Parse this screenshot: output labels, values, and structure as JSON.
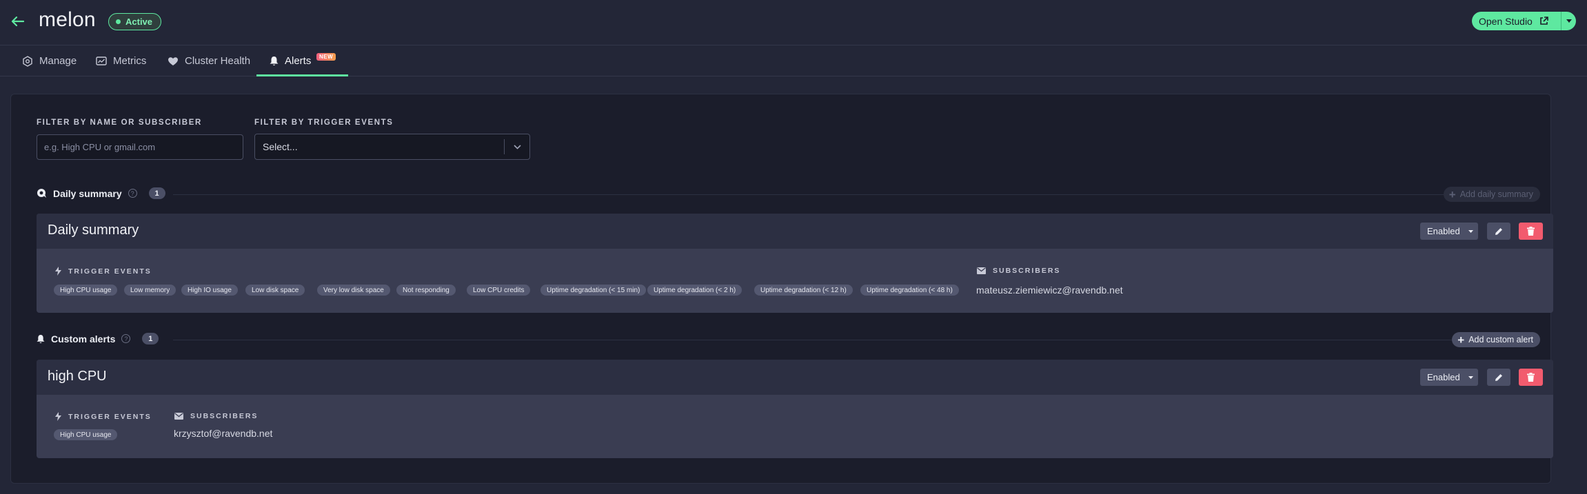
{
  "header": {
    "title": "melon",
    "status": "Active",
    "studio_label": "Open Studio"
  },
  "tabs": [
    {
      "label": "Manage",
      "icon": "gear-hex-icon"
    },
    {
      "label": "Metrics",
      "icon": "metrics-icon"
    },
    {
      "label": "Cluster Health",
      "icon": "heart-icon"
    },
    {
      "label": "Alerts",
      "icon": "bell-icon",
      "badge": "NEW",
      "active": true
    }
  ],
  "filters": {
    "name_label": "FILTER BY NAME OR SUBSCRIBER",
    "name_placeholder": "e.g. High CPU or gmail.com",
    "events_label": "FILTER BY TRIGGER EVENTS",
    "events_value": "Select..."
  },
  "daily_section": {
    "title": "Daily summary",
    "count": "1",
    "add_label": "Add daily summary",
    "card": {
      "title": "Daily summary",
      "state": "Enabled",
      "trigger_label": "TRIGGER EVENTS",
      "subscribers_label": "SUBSCRIBERS",
      "events": [
        "High CPU usage",
        "Low memory",
        "High IO usage",
        "Low disk space",
        "Very low disk space",
        "Not responding",
        "Low CPU credits",
        "Uptime degradation (< 15 min)",
        "Uptime degradation (< 2 h)",
        "Uptime degradation (< 12 h)",
        "Uptime degradation (< 48 h)"
      ],
      "subscriber": "mateusz.ziemiewicz@ravendb.net"
    }
  },
  "custom_section": {
    "title": "Custom alerts",
    "count": "1",
    "add_label": "Add custom alert",
    "card": {
      "title": "high CPU",
      "state": "Enabled",
      "trigger_label": "TRIGGER EVENTS",
      "subscribers_label": "SUBSCRIBERS",
      "events": [
        "High CPU usage"
      ],
      "subscriber": "krzysztof@ravendb.net"
    }
  },
  "colors": {
    "accent": "#5ee8a0",
    "danger": "#f25b6e",
    "background": "#232637"
  }
}
